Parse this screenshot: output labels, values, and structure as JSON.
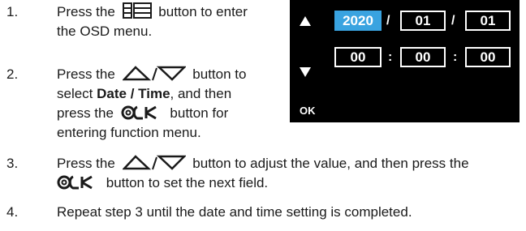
{
  "steps": [
    {
      "num": "1.",
      "text_a": "Press the",
      "text_b": "button to enter",
      "line2": "the OSD menu."
    },
    {
      "num": "2.",
      "text_a": "Press the",
      "text_b": "button to",
      "line2_a": "select ",
      "line2_bold": "Date / Time",
      "line2_b": ", and then",
      "line3_a": "press the",
      "line3_b": "button for",
      "line4": "entering function menu."
    },
    {
      "num": "3.",
      "text_a": "Press the",
      "text_b": "button to adjust the value, and then press the",
      "line2_b": "button to set the next field."
    },
    {
      "num": "4.",
      "text": "Repeat step 3 until the date and time setting is completed."
    }
  ],
  "osd": {
    "date": [
      "2020",
      "01",
      "01"
    ],
    "time": [
      "00",
      "00",
      "00"
    ],
    "date_sep": "/",
    "time_sep": ":",
    "ok_label": "OK",
    "selected_color": "#39a3e0"
  },
  "icons": [
    "menu-icon",
    "up-triangle-icon",
    "down-triangle-icon",
    "ok-icon"
  ]
}
